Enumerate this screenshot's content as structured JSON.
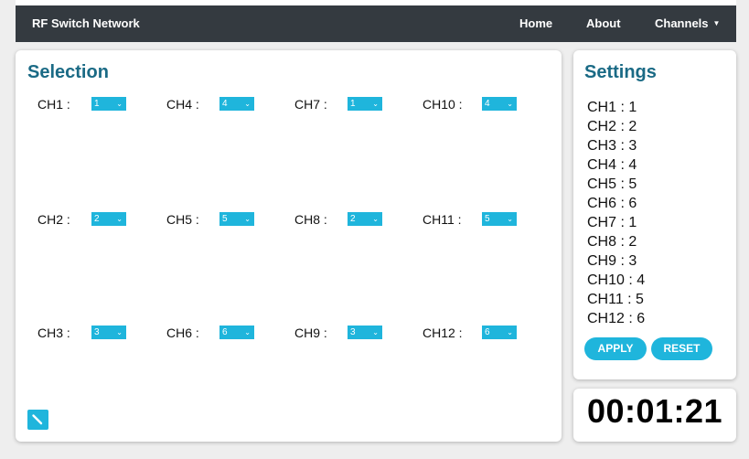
{
  "nav": {
    "brand": "RF Switch Network",
    "links": [
      "Home",
      "About",
      "Channels"
    ],
    "dropdown_caret": "▼"
  },
  "selection": {
    "title": "Selection",
    "channels": [
      {
        "label": "CH1 :",
        "value": "1"
      },
      {
        "label": "CH2 :",
        "value": "2"
      },
      {
        "label": "CH3 :",
        "value": "3"
      },
      {
        "label": "CH4 :",
        "value": "4"
      },
      {
        "label": "CH5 :",
        "value": "5"
      },
      {
        "label": "CH6 :",
        "value": "6"
      },
      {
        "label": "CH7 :",
        "value": "1"
      },
      {
        "label": "CH8 :",
        "value": "2"
      },
      {
        "label": "CH9 :",
        "value": "3"
      },
      {
        "label": "CH10 :",
        "value": "4"
      },
      {
        "label": "CH11 :",
        "value": "5"
      },
      {
        "label": "CH12 :",
        "value": "6"
      }
    ],
    "edit_icon": "pencil-icon"
  },
  "settings": {
    "title": "Settings",
    "items": [
      "CH1 : 1",
      "CH2 : 2",
      "CH3 : 3",
      "CH4 : 4",
      "CH5 : 5",
      "CH6 : 6",
      "CH7 : 1",
      "CH8 : 2",
      "CH9 : 3",
      "CH10 : 4",
      "CH11 : 5",
      "CH12 : 6"
    ],
    "apply_label": "APPLY",
    "reset_label": "RESET"
  },
  "timer": {
    "value": "00:01:21"
  },
  "colors": {
    "navbar": "#343a40",
    "accent": "#1fb5dc",
    "title": "#1a6a85",
    "page_bg": "#eeeeee"
  }
}
